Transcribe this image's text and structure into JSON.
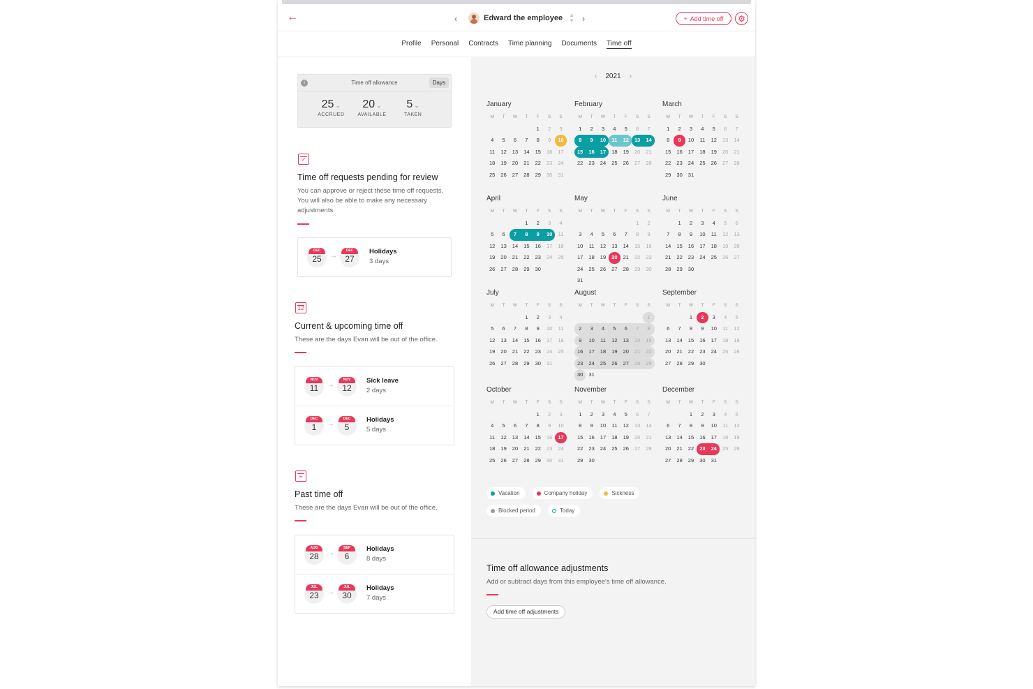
{
  "header": {
    "back_icon": "arrow-left-icon",
    "employee_name": "Edward the employee",
    "prev_icon": "‹",
    "next_icon": "›",
    "add_button": "Add time off",
    "settings_icon": "gear-icon"
  },
  "tabs": [
    "Profile",
    "Personal",
    "Contracts",
    "Time planning",
    "Documents",
    "Time off"
  ],
  "active_tab": "Time off",
  "allowance": {
    "title": "Time off allowance",
    "unit": "Days",
    "accrued_value": "25",
    "accrued_label": "ACCRUED",
    "available_value": "20",
    "available_label": "AVAILABLE",
    "taken_value": "5",
    "taken_label": "TAKEN"
  },
  "pending": {
    "title": "Time off requests pending for review",
    "description": "You can approve or reject these time off requests. You will also be able to make any necessary adjustments.",
    "items": [
      {
        "from_month": "DEC",
        "from_day": "25",
        "to_month": "DEC",
        "to_day": "27",
        "type": "Holidays",
        "length": "3 days"
      }
    ]
  },
  "upcoming": {
    "title": "Current & upcoming time off",
    "description": "These are the days Evan will be out of the office.",
    "items": [
      {
        "from_month": "NOV",
        "from_day": "11",
        "to_month": "NOV",
        "to_day": "12",
        "type": "Sick leave",
        "length": "2 days"
      },
      {
        "from_month": "DEC",
        "from_day": "1",
        "to_month": "DEC",
        "to_day": "5",
        "type": "Holidays",
        "length": "5 days"
      }
    ]
  },
  "past": {
    "title": "Past time off",
    "description": "These are the days Evan will be out of the office.",
    "items": [
      {
        "from_month": "AUG",
        "from_day": "28",
        "to_month": "SEP",
        "to_day": "6",
        "type": "Holidays",
        "length": "8 days"
      },
      {
        "from_month": "JUL",
        "from_day": "23",
        "to_month": "JUL",
        "to_day": "30",
        "type": "Holidays",
        "length": "7 days"
      }
    ]
  },
  "calendar": {
    "year": "2021",
    "weekdays": [
      "M",
      "T",
      "W",
      "T",
      "F",
      "S",
      "S"
    ],
    "months": [
      {
        "name": "January",
        "offset": 4,
        "days": 31,
        "teal": [],
        "lteal": [],
        "red": [],
        "orange": [
          10
        ],
        "grey": []
      },
      {
        "name": "February",
        "offset": 0,
        "days": 28,
        "teal": [
          8,
          9,
          10,
          13,
          14,
          15,
          16,
          17
        ],
        "lteal": [
          11,
          12
        ],
        "red": [],
        "orange": [],
        "grey": []
      },
      {
        "name": "March",
        "offset": 0,
        "days": 31,
        "teal": [],
        "lteal": [],
        "red": [
          9
        ],
        "orange": [],
        "grey": []
      },
      {
        "name": "April",
        "offset": 3,
        "days": 30,
        "teal": [
          7,
          8,
          9,
          10
        ],
        "lteal": [],
        "red": [],
        "orange": [],
        "grey": []
      },
      {
        "name": "May",
        "offset": 5,
        "days": 31,
        "teal": [],
        "lteal": [],
        "red": [
          20
        ],
        "orange": [],
        "grey": []
      },
      {
        "name": "June",
        "offset": 1,
        "days": 30,
        "teal": [],
        "lteal": [],
        "red": [],
        "orange": [],
        "grey": []
      },
      {
        "name": "July",
        "offset": 3,
        "days": 31,
        "teal": [],
        "lteal": [],
        "red": [],
        "orange": [],
        "grey": []
      },
      {
        "name": "August",
        "offset": 6,
        "days": 31,
        "teal": [],
        "lteal": [],
        "red": [],
        "orange": [],
        "grey": [
          1,
          2,
          3,
          4,
          5,
          6,
          7,
          8,
          9,
          10,
          11,
          12,
          13,
          14,
          15,
          16,
          17,
          18,
          19,
          20,
          21,
          22,
          23,
          24,
          25,
          26,
          27,
          28,
          29,
          30
        ]
      },
      {
        "name": "September",
        "offset": 2,
        "days": 30,
        "teal": [],
        "lteal": [],
        "red": [
          2
        ],
        "orange": [],
        "grey": []
      },
      {
        "name": "October",
        "offset": 4,
        "days": 31,
        "teal": [],
        "lteal": [],
        "red": [
          17
        ],
        "orange": [],
        "grey": []
      },
      {
        "name": "November",
        "offset": 0,
        "days": 30,
        "teal": [],
        "lteal": [],
        "red": [],
        "orange": [],
        "grey": []
      },
      {
        "name": "December",
        "offset": 2,
        "days": 31,
        "teal": [],
        "lteal": [],
        "red": [
          23,
          24
        ],
        "orange": [],
        "grey": []
      }
    ]
  },
  "legend": [
    {
      "label": "Vacation",
      "color": "#0b9ea3"
    },
    {
      "label": "Company holiday",
      "color": "#e8385a"
    },
    {
      "label": "Sickness",
      "color": "#f3b93f"
    },
    {
      "label": "Blocked period",
      "color": "#9b9b9b"
    },
    {
      "label": "Today",
      "color": "ring"
    }
  ],
  "adjustments": {
    "title": "Time off allowance adjustments",
    "description": "Add or subtract days from this employee's time off allowance.",
    "button": "Add time off adjustments"
  }
}
